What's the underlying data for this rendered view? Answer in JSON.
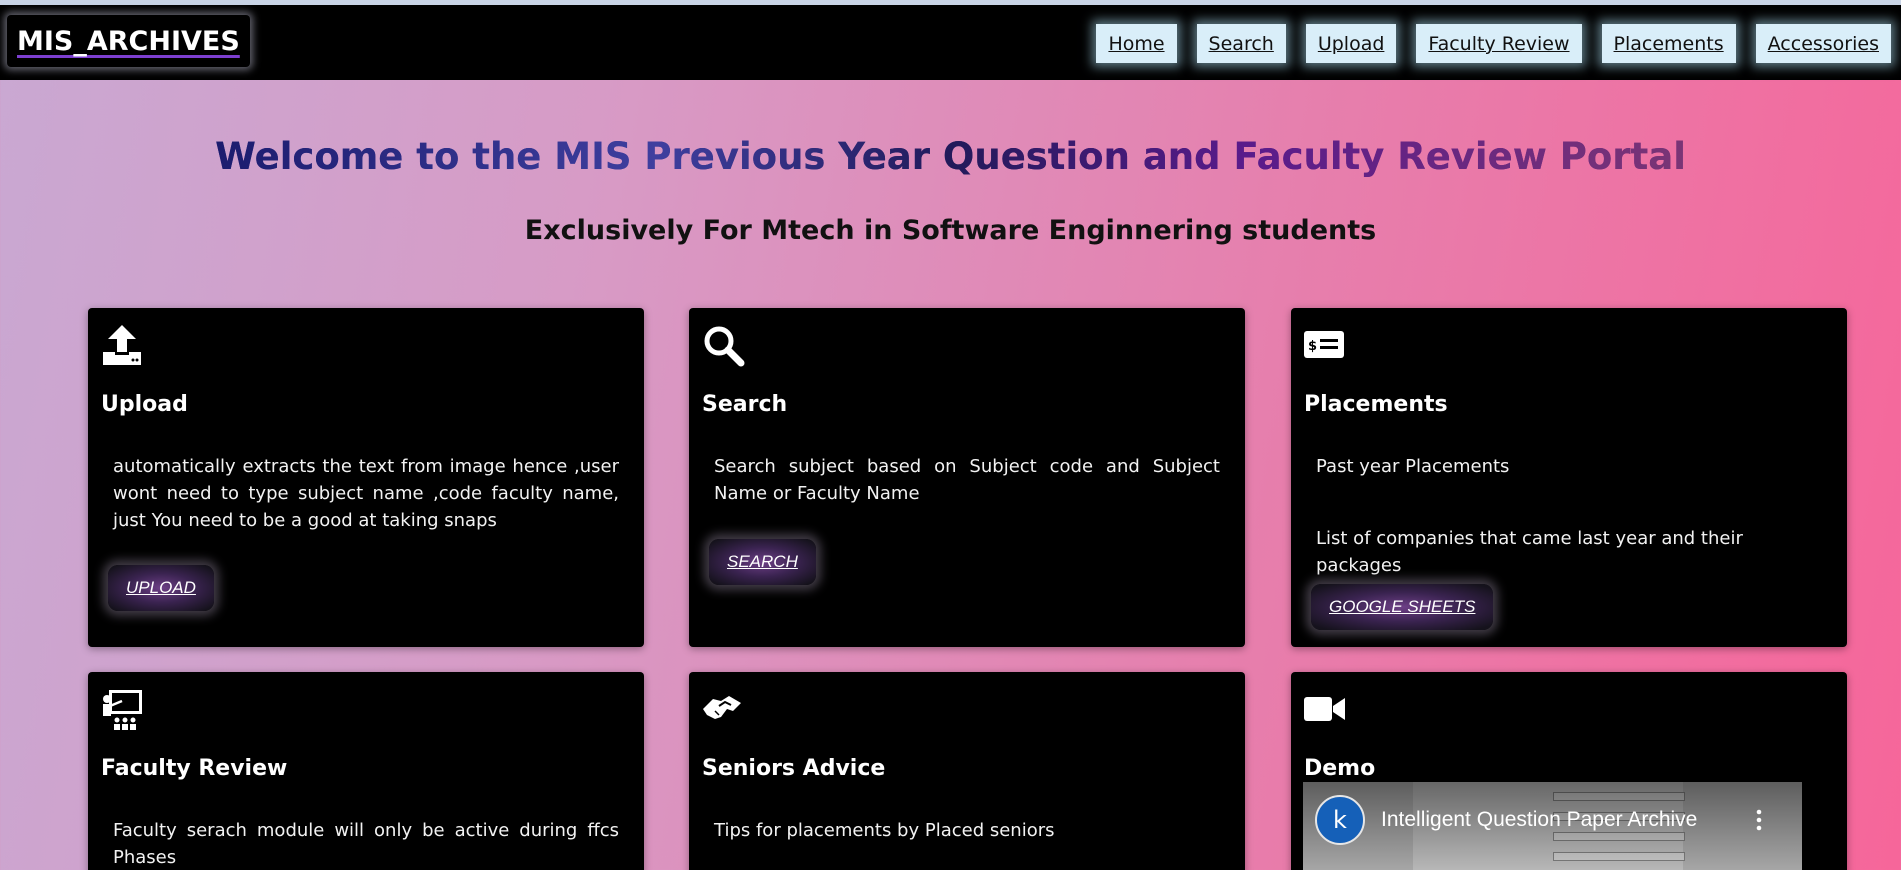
{
  "brand": "MIS_ARCHIVES",
  "nav": [
    "Home",
    "Search",
    "Upload",
    "Faculty Review",
    "Placements",
    "Accessories"
  ],
  "hero": {
    "title": "Welcome to the MIS Previous Year Question and Faculty Review Portal",
    "subtitle": "Exclusively For Mtech in Software Enginnering students"
  },
  "cards": {
    "upload": {
      "icon": "upload-icon",
      "title": "Upload",
      "desc": "automatically extracts the text from image hence ,user wont need to type subject name ,code faculty name, just You need to be a good at taking snaps",
      "button": "UPLOAD"
    },
    "search": {
      "icon": "search-icon",
      "title": "Search",
      "desc": "Search subject based on Subject code and Subject Name or Faculty Name",
      "button": "SEARCH"
    },
    "placements": {
      "icon": "money-check-icon",
      "title": "Placements",
      "desc": "Past year Placements",
      "desc2": "List of companies that came last year and their packages",
      "button": "GOOGLE SHEETS"
    },
    "faculty": {
      "icon": "teacher-icon",
      "title": "Faculty Review",
      "desc": "Faculty serach module will only be active during ffcs Phases"
    },
    "seniors": {
      "icon": "handshake-icon",
      "title": "Seniors Advice",
      "desc": "Tips for placements by Placed seniors"
    },
    "demo": {
      "icon": "video-camera-icon",
      "title": "Demo",
      "video_title": "Intelligent Question Paper Archive",
      "channel_initial": "k"
    }
  },
  "colors": {
    "navbar": "#000000",
    "card": "#000000",
    "nav_link_bg": "#d9eef9",
    "brand_underline": "#7d3fd0"
  }
}
